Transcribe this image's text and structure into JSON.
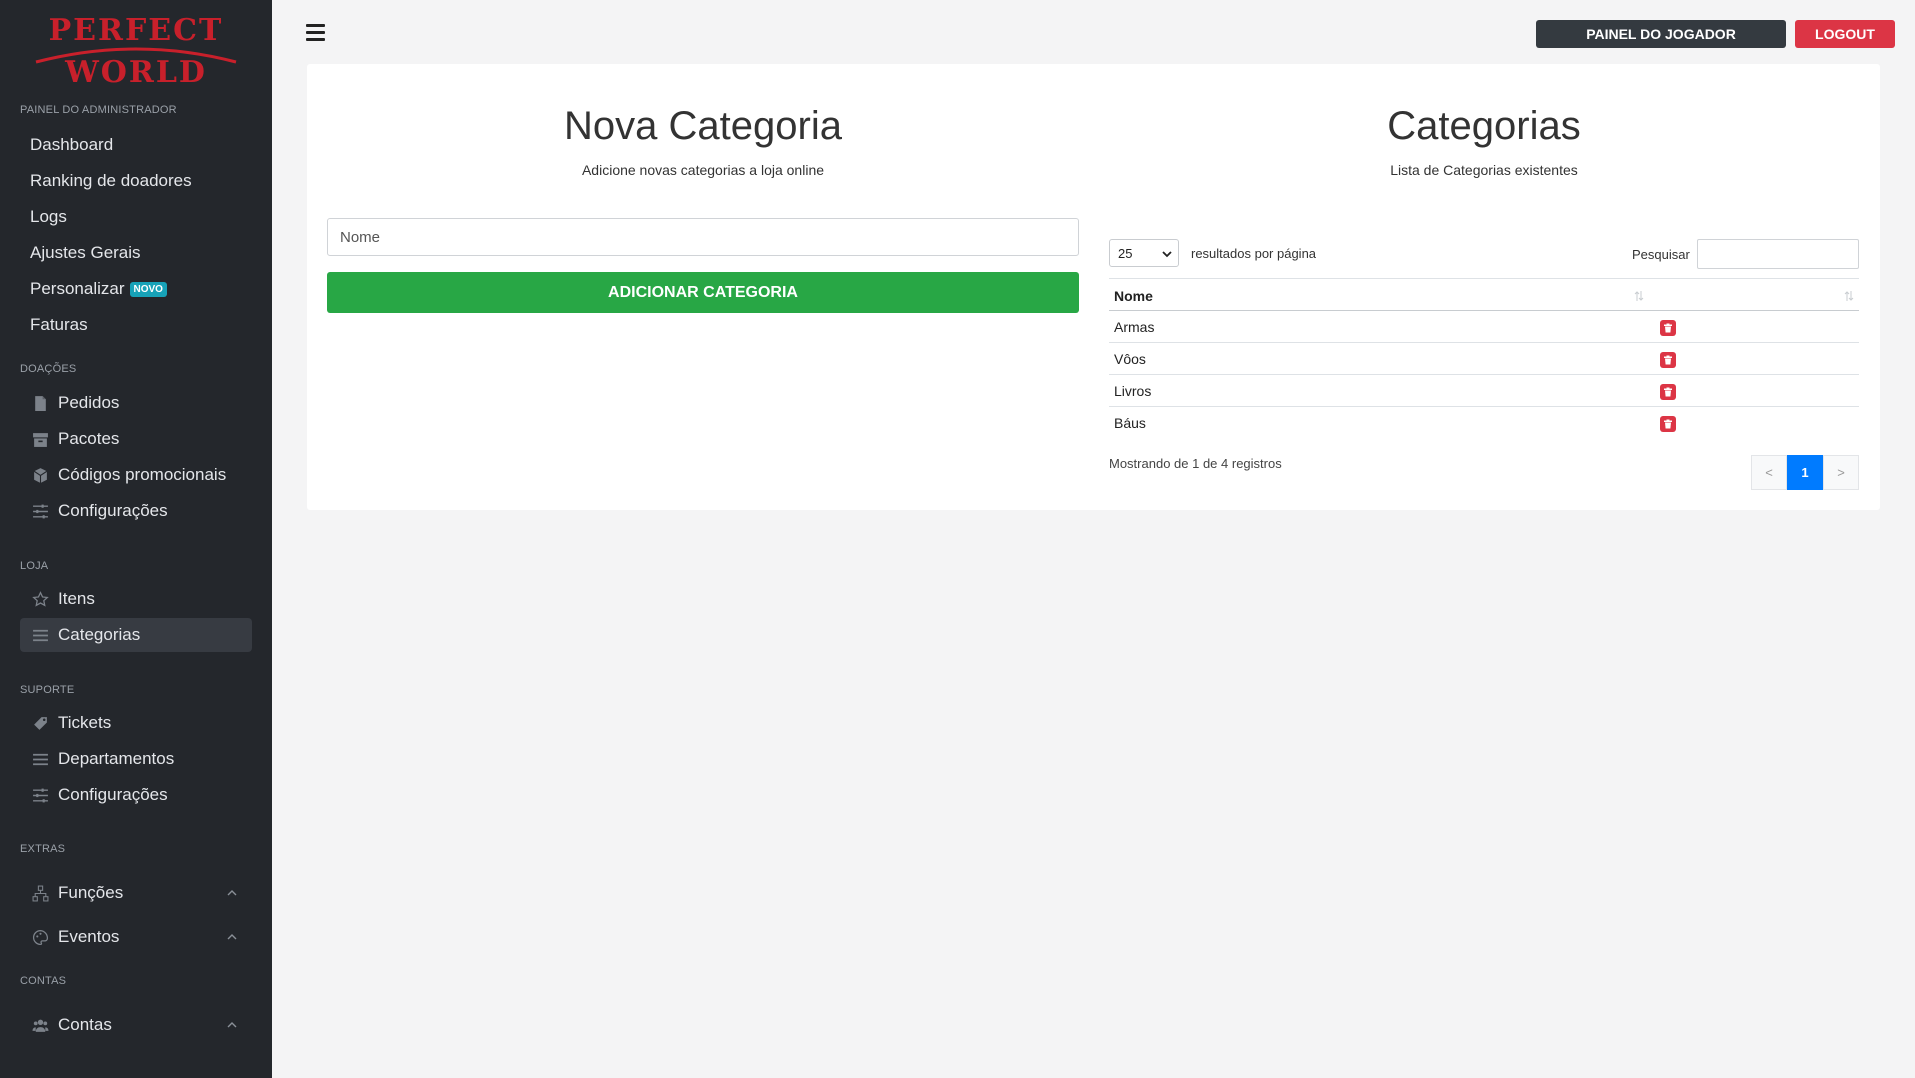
{
  "brand": {
    "line1": "PERFECT",
    "line2": "WORLD"
  },
  "sidebar": {
    "sections": {
      "admin": "PAINEL DO ADMINISTRADOR",
      "doacoes": "DOAÇÕES",
      "loja": "LOJA",
      "suporte": "SUPORTE",
      "extras": "EXTRAS",
      "contas": "CONTAS"
    },
    "admin_items": [
      {
        "label": "Dashboard"
      },
      {
        "label": "Ranking de doadores"
      },
      {
        "label": "Logs"
      },
      {
        "label": "Ajustes Gerais"
      },
      {
        "label": "Personalizar",
        "badge": "NOVO"
      },
      {
        "label": "Faturas"
      }
    ],
    "doacoes_items": [
      {
        "label": "Pedidos",
        "icon": "file-icon"
      },
      {
        "label": "Pacotes",
        "icon": "box-icon"
      },
      {
        "label": "Códigos promocionais",
        "icon": "cube-icon"
      },
      {
        "label": "Configurações",
        "icon": "sliders-icon"
      }
    ],
    "loja_items": [
      {
        "label": "Itens",
        "icon": "star-icon"
      },
      {
        "label": "Categorias",
        "icon": "list-icon",
        "active": true
      }
    ],
    "suporte_items": [
      {
        "label": "Tickets",
        "icon": "tag-icon"
      },
      {
        "label": "Departamentos",
        "icon": "list-icon"
      },
      {
        "label": "Configurações",
        "icon": "sliders-icon"
      }
    ],
    "extras_items": [
      {
        "label": "Funções",
        "icon": "sitemap-icon"
      },
      {
        "label": "Eventos",
        "icon": "palette-icon"
      }
    ],
    "contas_items": [
      {
        "label": "Contas",
        "icon": "users-icon"
      }
    ]
  },
  "header": {
    "player_panel_label": "PAINEL DO JOGADOR",
    "logout_label": "LOGOUT"
  },
  "new_category": {
    "title": "Nova Categoria",
    "subtitle": "Adicione novas categorias a loja online",
    "name_placeholder": "Nome",
    "add_button": "ADICIONAR CATEGORIA"
  },
  "categories": {
    "title": "Categorias",
    "subtitle": "Lista de Categorias existentes",
    "page_length": "25",
    "page_length_label": "resultados por página",
    "search_label": "Pesquisar",
    "column_name": "Nome",
    "rows": [
      {
        "name": "Armas"
      },
      {
        "name": "Vôos"
      },
      {
        "name": "Livros"
      },
      {
        "name": "Báus"
      }
    ],
    "info": "Mostrando de 1 de 4 registros",
    "pagination": {
      "prev": "<",
      "current": "1",
      "next": ">"
    }
  },
  "colors": {
    "sidebar_bg": "#24272c",
    "accent_green": "#28a745",
    "logout_red": "#dc3545",
    "active_page_blue": "#007bff",
    "badge_teal": "#17a2b8"
  }
}
